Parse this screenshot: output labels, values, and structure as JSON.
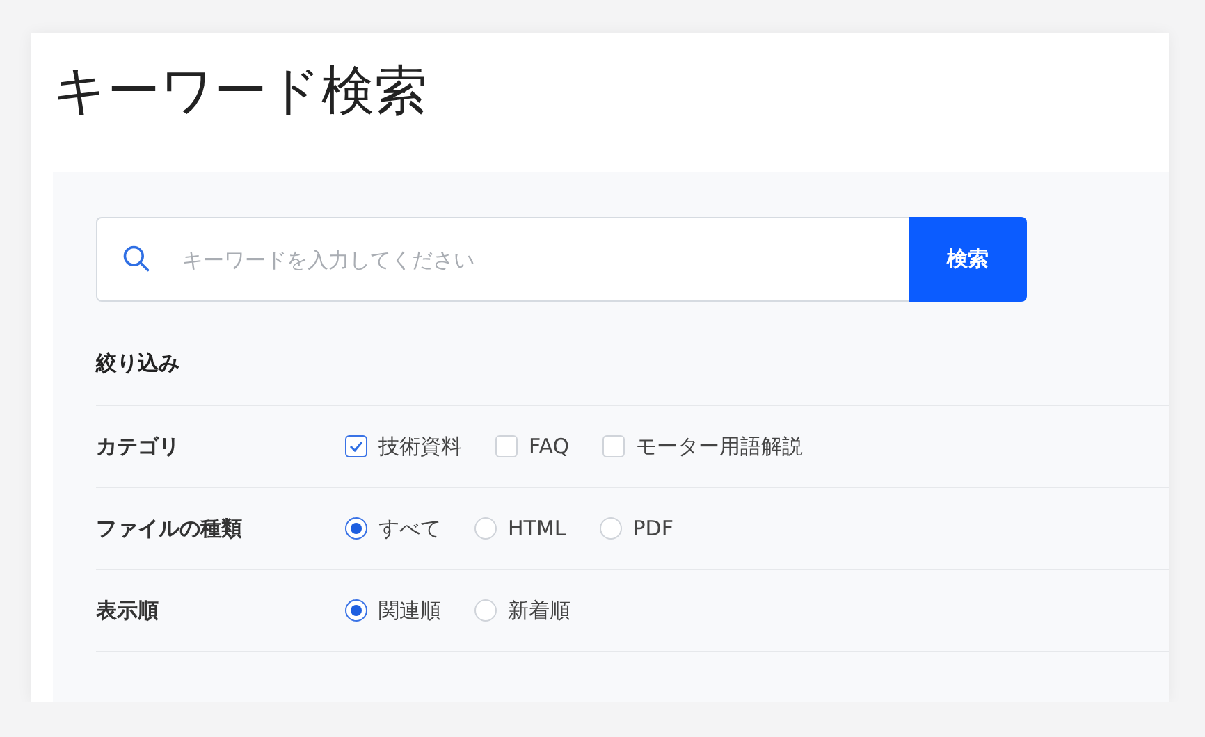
{
  "title": "キーワード検索",
  "search": {
    "placeholder": "キーワードを入力してください",
    "button": "検索"
  },
  "filter_heading": "絞り込み",
  "filters": [
    {
      "label": "カテゴリ",
      "kind": "checkbox",
      "options": [
        {
          "label": "技術資料",
          "checked": true
        },
        {
          "label": "FAQ",
          "checked": false
        },
        {
          "label": "モーター用語解説",
          "checked": false
        }
      ]
    },
    {
      "label": "ファイルの種類",
      "kind": "radio",
      "options": [
        {
          "label": "すべて",
          "selected": true
        },
        {
          "label": "HTML",
          "selected": false
        },
        {
          "label": "PDF",
          "selected": false
        }
      ]
    },
    {
      "label": "表示順",
      "kind": "radio",
      "options": [
        {
          "label": "関連順",
          "selected": true
        },
        {
          "label": "新着順",
          "selected": false
        }
      ]
    }
  ]
}
